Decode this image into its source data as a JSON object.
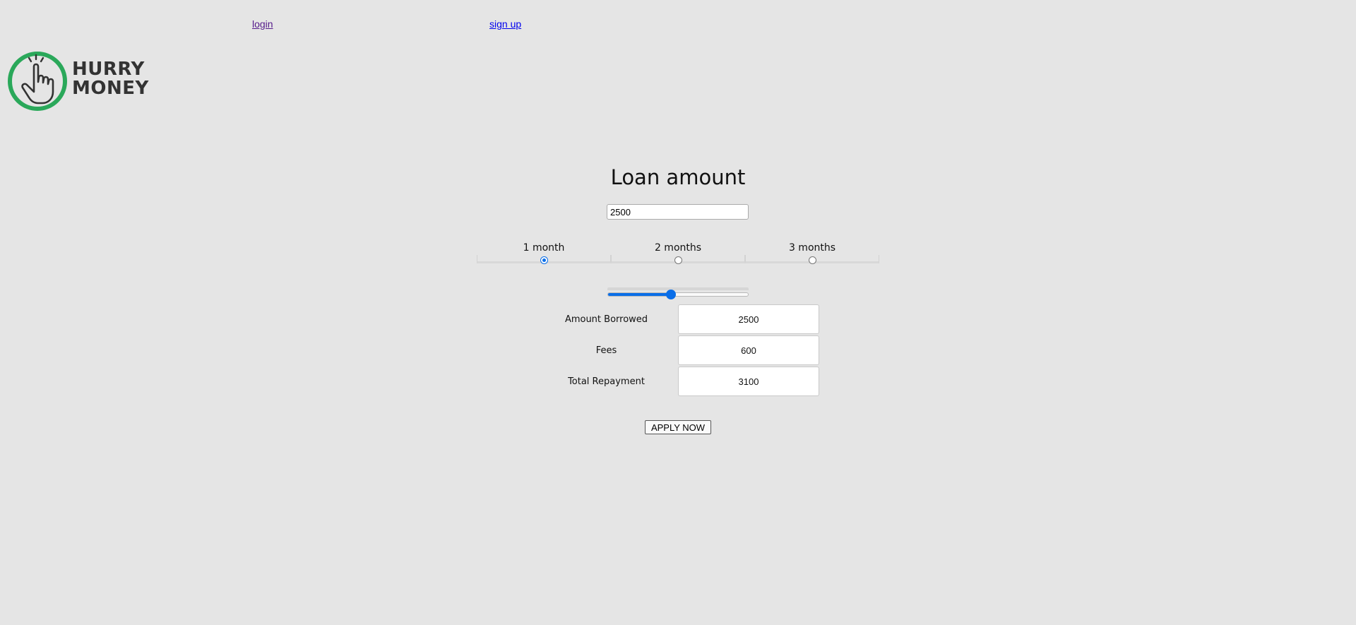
{
  "nav": {
    "login_label": "login",
    "signup_label": "sign up"
  },
  "logo": {
    "line1": "HURRY",
    "line2": "MONEY",
    "ring_color": "#2aa85a",
    "text_color": "#333333",
    "icon": "pointing-hand-icon"
  },
  "main": {
    "title": "Loan amount",
    "amount_value": "2500",
    "terms": [
      {
        "label": "1 month",
        "selected": true
      },
      {
        "label": "2 months",
        "selected": false
      },
      {
        "label": "3 months",
        "selected": false
      }
    ],
    "slider": {
      "fraction": 0.45,
      "accent_color": "#0a6ee8"
    }
  },
  "summary": {
    "amount_borrowed_label": "Amount Borrowed",
    "amount_borrowed_value": "2500",
    "fees_label": "Fees",
    "fees_value": "600",
    "total_label": "Total Repayment",
    "total_value": "3100"
  },
  "apply_label": "APPLY NOW"
}
